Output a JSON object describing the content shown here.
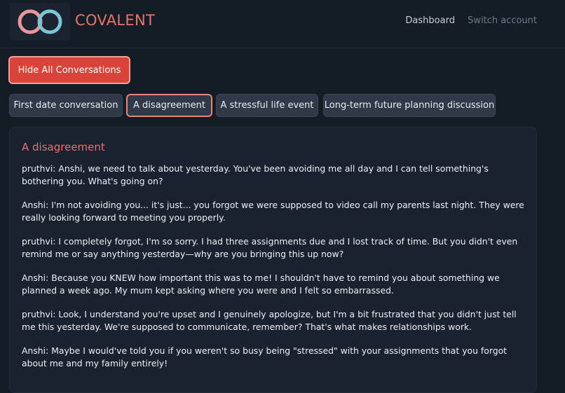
{
  "header": {
    "brand": "COVALENT",
    "nav": {
      "dashboard": "Dashboard",
      "switch_account": "Switch account"
    },
    "logo": {
      "ring_left_color": "#e8969a",
      "ring_right_color": "#7fc4d2"
    }
  },
  "controls": {
    "hide_all_label": "Hide All Conversations"
  },
  "tabs": [
    {
      "label": "First date conversation",
      "active": false
    },
    {
      "label": "A disagreement",
      "active": true
    },
    {
      "label": "A stressful life event",
      "active": false
    },
    {
      "label": "Long-term future planning discussion",
      "active": false
    }
  ],
  "conversation": {
    "title": "A disagreement",
    "messages": [
      "pruthvi: Anshi, we need to talk about yesterday. You've been avoiding me all day and I can tell something's bothering you. What's going on?",
      "Anshi: I'm not avoiding you... it's just... you forgot we were supposed to video call my parents last night. They were really looking forward to meeting you properly.",
      "pruthvi: I completely forgot, I'm so sorry. I had three assignments due and I lost track of time. But you didn't even remind me or say anything yesterday—why are you bringing this up now?",
      "Anshi: Because you KNEW how important this was to me! I shouldn't have to remind you about something we planned a week ago. My mum kept asking where you were and I felt so embarrassed.",
      "pruthvi: Look, I understand you're upset and I genuinely apologize, but I'm a bit frustrated that you didn't just tell me this yesterday. We're supposed to communicate, remember? That's what makes relationships work.",
      "Anshi: Maybe I would've told you if you weren't so busy being \"stressed\" with your assignments that you forgot about me and my family entirely!"
    ]
  },
  "colors": {
    "background": "#141c26",
    "accent": "#e8746a",
    "primary_button": "#d9443a",
    "tab_background": "#2f3947"
  }
}
